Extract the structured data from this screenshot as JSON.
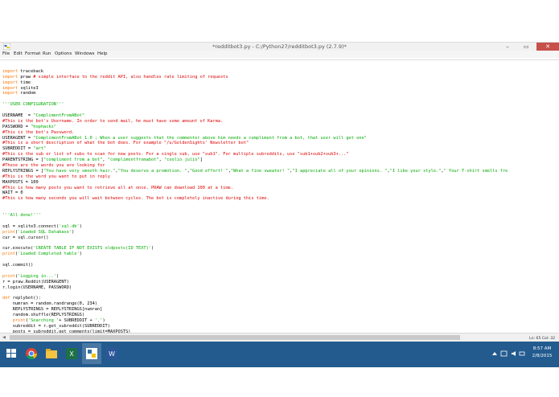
{
  "window": {
    "title": "*redditbot3.py - C:/Python27/redditbot3.py (2.7.9)*",
    "controls": {
      "minimize": "–",
      "maximize": "▭",
      "close": "✕"
    }
  },
  "menu": {
    "items": [
      "File",
      "Edit",
      "Format",
      "Run",
      "Options",
      "Windows",
      "Help"
    ]
  },
  "code_lines": [
    "",
    "import traceback",
    "import praw # simple interface to the reddit API, also handles rate limiting of requests",
    "import time",
    "import sqlite3",
    "import random",
    "",
    "'''USER CONFIGURATION'''",
    "",
    "USERNAME  = \"ComplimentFromABot\"",
    "#This is the bot's Username. In order to send mail, he must have some amount of Karma.",
    "PASSWORD = \"hophacks\"",
    "#This is the bot's Password.",
    "USERAGENT = \"ComplimentFromABot 1.0 ; When a user suggests that the commenter above him needs a compliment from a bot, that user will get one\"",
    "#This is a short description of what the bot does. For example \"/u/GoldenSights' Newsletter bot\"",
    "SUBREDDIT = \"art\"",
    "#This is the sub or list of subs to scan for new posts. For a single sub, use \"sub1\". For multiple subreddits, use \"sub1+sub2+sub3+...\"",
    "PARENTSTRING = [\"compliment from a bot\", \"complimentfromabot\", \"coolio julio\"]",
    "#These are the words you are looking for",
    "REPLYSTRINGS = [\"You have very smooth hair.\",\"You deserve a promotion. \",\"Good effort! \",\"What a fine sweater! \",\"I appreciate all of your opinions. \",\"I like your style.\",\" Your T-shirt smells fre",
    "#This is the word you want to put in reply",
    "MAXPOSTS = 100",
    "#This is how many posts you want to retrieve all at once. PRAW can download 100 at a time.",
    "WAIT = 0",
    "#This is how many seconds you will wait between cycles. The bot is completely inactive during this time.",
    "",
    "",
    "'''All done!'''",
    "",
    "sql = sqlite3.connect('sql.db')",
    "print('Loaded SQL Database')",
    "cur = sql.cursor()",
    "",
    "cur.execute('CREATE TABLE IF NOT EXISTS oldposts(ID TEXT)')",
    "print('Loaded Completed table')",
    "",
    "sql.commit()",
    "",
    "print('Logging in...')",
    "r = praw.Reddit(USERAGENT)",
    "r.login(USERNAME, PASSWORD)",
    "",
    "def replybot():",
    "    numran = random.randrange(0, 234)",
    "    REPLYSTRINGS = REPLYSTRINGS[numran]",
    "    random.shuffle(REPLYSTRINGS)",
    "    print('Searching '+ SUBREDDIT + '.')",
    "    subreddit = r.get_subreddit(SUBREDDIT)",
    "    posts = subreddit.get_comments(limit=MAXPOSTS)",
    "    for post in posts:"
  ],
  "status_bar": {
    "position": "Ln: 65 Col: 32"
  },
  "taskbar": {
    "apps": [
      "start-button",
      "ie-icon",
      "chrome-icon",
      "file-explorer-icon",
      "store-icon",
      "excel-icon",
      "python-idle-icon",
      "word-icon"
    ],
    "time": "8:57 AM",
    "date": "2/8/2015"
  },
  "colors": {
    "keyword": "#ff7700",
    "string": "#00aa00",
    "comment": "#dd0000",
    "builtin": "#900090",
    "taskbar": "#235b8f"
  }
}
